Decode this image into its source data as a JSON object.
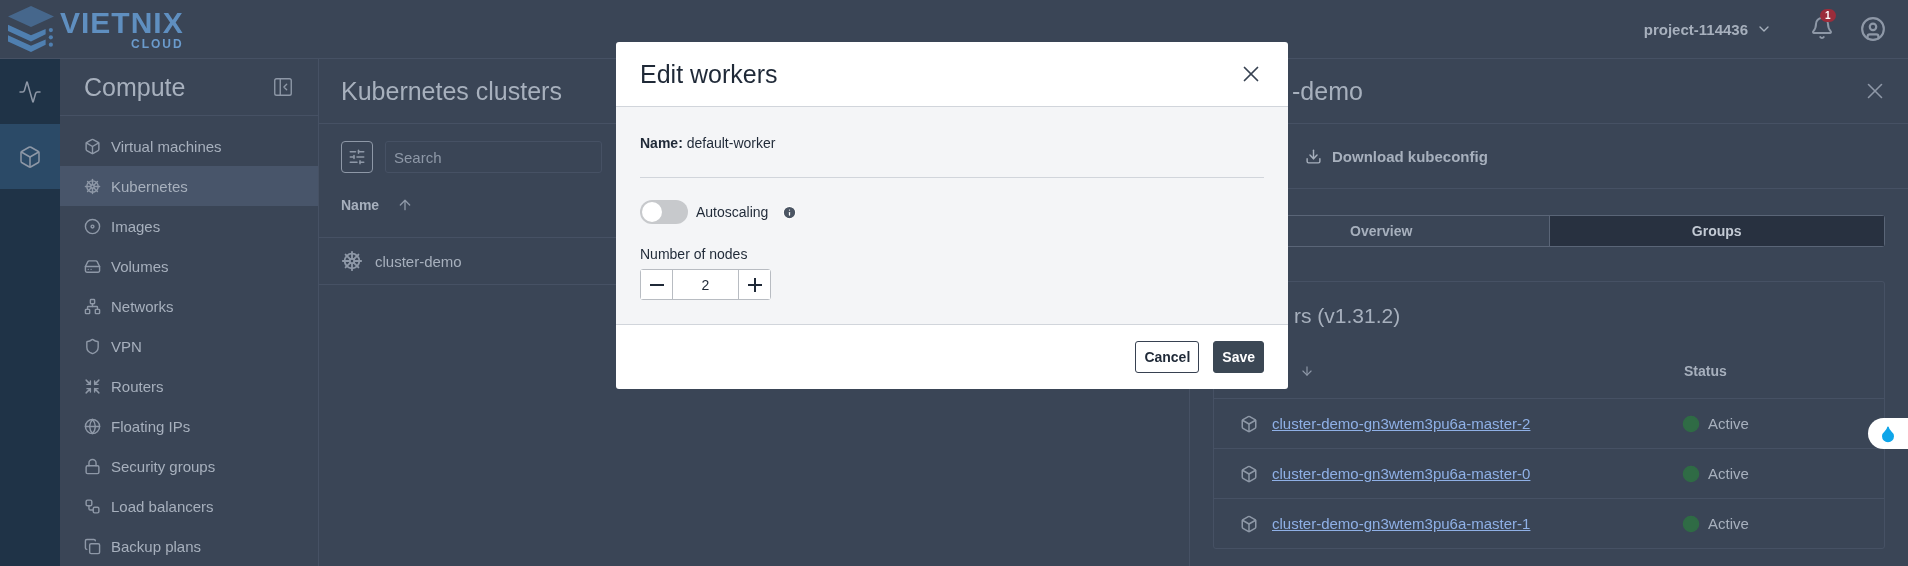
{
  "header": {
    "logo": {
      "name": "VIETNIX",
      "tagline": "CLOUD"
    },
    "project": "project-114436",
    "notifications": "1"
  },
  "rail": [
    {
      "kind": "pulse",
      "selected": false
    },
    {
      "kind": "cube",
      "selected": true
    }
  ],
  "sidebar": {
    "title": "Compute",
    "items": [
      {
        "label": "Virtual machines",
        "kind": "cube",
        "selected": false
      },
      {
        "label": "Kubernetes",
        "kind": "wheel",
        "selected": true
      },
      {
        "label": "Images",
        "kind": "disc",
        "selected": false
      },
      {
        "label": "Volumes",
        "kind": "drive",
        "selected": false
      },
      {
        "label": "Networks",
        "kind": "nodes",
        "selected": false
      },
      {
        "label": "VPN",
        "kind": "shield",
        "selected": false
      },
      {
        "label": "Routers",
        "kind": "arrows",
        "selected": false
      },
      {
        "label": "Floating IPs",
        "kind": "globe",
        "selected": false
      },
      {
        "label": "Security groups",
        "kind": "lock",
        "selected": false
      },
      {
        "label": "Load balancers",
        "kind": "tree",
        "selected": false
      },
      {
        "label": "Backup plans",
        "kind": "copy",
        "selected": false
      }
    ]
  },
  "main": {
    "title": "Kubernetes clusters",
    "search": {
      "placeholder": "Search"
    },
    "columns": [
      "Name"
    ],
    "rows": [
      "cluster-demo"
    ]
  },
  "drawer": {
    "title": "-demo",
    "action": "Download kubeconfig",
    "tabs": [
      {
        "label": "Overview",
        "selected": false
      },
      {
        "label": "Groups",
        "selected": true
      }
    ],
    "card_title": "rs (v1.31.2)",
    "columns": [
      "Status"
    ],
    "rows": [
      {
        "name": "cluster-demo-gn3wtem3pu6a-master-2",
        "status": "Active"
      },
      {
        "name": "cluster-demo-gn3wtem3pu6a-master-0",
        "status": "Active"
      },
      {
        "name": "cluster-demo-gn3wtem3pu6a-master-1",
        "status": "Active"
      }
    ]
  },
  "dialog": {
    "title": "Edit workers",
    "name_line": "**Name:** default-worker",
    "autoscaling": {
      "label": "Autoscaling",
      "on": false
    },
    "nodes": {
      "label": "Number of nodes",
      "value": "2"
    },
    "buttons": [
      {
        "label": "Cancel",
        "kind": "secondary"
      },
      {
        "label": "Save",
        "kind": "primary"
      }
    ]
  }
}
